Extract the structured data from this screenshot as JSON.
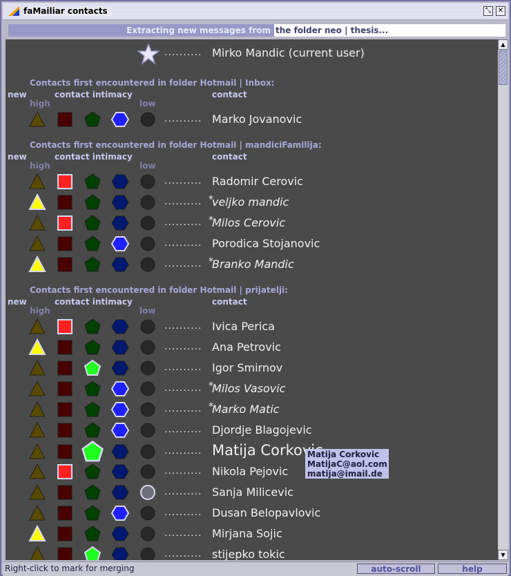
{
  "window": {
    "title": "faMailiar contacts"
  },
  "status": {
    "label": "Extracting new messages from",
    "value": "the folder neo | thesis..."
  },
  "current_user": {
    "dots": "..........",
    "name": "Mirko Mandic (current user)"
  },
  "headers": {
    "new": "new",
    "intimacy": "contact intimacy",
    "contact": "contact",
    "high": "high",
    "low": "low"
  },
  "sections": [
    {
      "title": "Contacts first encountered in folder Hotmail | Inbox:"
    },
    {
      "title": "Contacts first encountered in folder Hotmail | mandiciFamilija:"
    },
    {
      "title": "Contacts first encountered in folder Hotmail | prijatelji:"
    }
  ],
  "contacts": [
    {
      "name": "Marko Jovanovic",
      "marked": false,
      "italic": false,
      "levels": [
        "tri",
        "sq",
        "pent",
        "HEX",
        "circ"
      ]
    },
    {
      "name": "Radomir Cerovic",
      "marked": false,
      "italic": false,
      "levels": [
        "tri",
        "SQ",
        "pent",
        "hex",
        "circ"
      ]
    },
    {
      "name": "veljko mandic",
      "marked": true,
      "italic": true,
      "levels": [
        "TRI",
        "sq",
        "pent",
        "hex",
        "circ"
      ]
    },
    {
      "name": "Milos Cerovic",
      "marked": true,
      "italic": true,
      "levels": [
        "tri",
        "SQ",
        "pent",
        "hex",
        "circ"
      ]
    },
    {
      "name": "Porodica Stojanovic",
      "marked": false,
      "italic": false,
      "levels": [
        "tri",
        "sq",
        "pent",
        "HEX",
        "circ"
      ]
    },
    {
      "name": "Branko Mandic",
      "marked": true,
      "italic": true,
      "levels": [
        "TRI",
        "sq",
        "pent",
        "hex",
        "circ"
      ]
    },
    {
      "name": "Ivica Perica",
      "marked": false,
      "italic": false,
      "levels": [
        "tri",
        "SQ",
        "pent",
        "hex",
        "circ"
      ]
    },
    {
      "name": "Ana Petrovic",
      "marked": false,
      "italic": false,
      "levels": [
        "TRI",
        "sq",
        "pent",
        "hex",
        "circ"
      ]
    },
    {
      "name": "Igor Smirnov",
      "marked": false,
      "italic": false,
      "levels": [
        "tri",
        "sq",
        "PENT",
        "hex",
        "circ"
      ]
    },
    {
      "name": "Milos Vasovic",
      "marked": true,
      "italic": true,
      "levels": [
        "tri",
        "sq",
        "pent",
        "HEX",
        "circ"
      ]
    },
    {
      "name": "Marko Matic",
      "marked": true,
      "italic": true,
      "levels": [
        "tri",
        "sq",
        "pent",
        "HEX",
        "circ"
      ]
    },
    {
      "name": "Djordje Blagojevic",
      "marked": false,
      "italic": false,
      "levels": [
        "tri",
        "sq",
        "pent",
        "HEX",
        "circ"
      ]
    },
    {
      "name": "Matija Corkovic",
      "marked": false,
      "italic": false,
      "big": true,
      "levels": [
        "tri",
        "sq",
        "BIGPENT",
        "hex",
        "circ"
      ]
    },
    {
      "name": "Nikola Pejovic",
      "marked": false,
      "italic": false,
      "levels": [
        "tri",
        "SQ",
        "pent",
        "hex",
        "circ"
      ]
    },
    {
      "name": "Sanja Milicevic",
      "marked": false,
      "italic": false,
      "levels": [
        "tri",
        "sq",
        "pent",
        "hex",
        "CIRC"
      ]
    },
    {
      "name": "Dusan Belopavlovic",
      "marked": false,
      "italic": false,
      "levels": [
        "tri",
        "sq",
        "pent",
        "HEX",
        "circ"
      ]
    },
    {
      "name": "Mirjana Sojic",
      "marked": false,
      "italic": false,
      "levels": [
        "TRI",
        "sq",
        "pent",
        "hex",
        "circ"
      ]
    },
    {
      "name": "stijepko tokic",
      "marked": false,
      "italic": false,
      "levels": [
        "tri",
        "sq",
        "PENT",
        "hex",
        "circ"
      ]
    }
  ],
  "dots": "..........",
  "tooltip": {
    "name": "Matija Corkovic",
    "email1": "MatijaC@aol.com",
    "email2": "matija@imail.de"
  },
  "footer": {
    "hint": "Right-click to mark for merging",
    "autoscroll": "auto-scroll",
    "help": "help"
  },
  "colors": {
    "panel": "#4a4a4a",
    "accent": "#9898c8",
    "tri_dim": "#5a4a00",
    "tri_bright": "#ffff00",
    "sq_dim": "#480000",
    "sq_bright": "#ff2020",
    "pent_dim": "#004000",
    "pent_bright": "#20ff20",
    "hex_dim": "#001870",
    "hex_bright": "#2020ff",
    "circ_dim": "#282828",
    "circ_bright": "#707078"
  }
}
